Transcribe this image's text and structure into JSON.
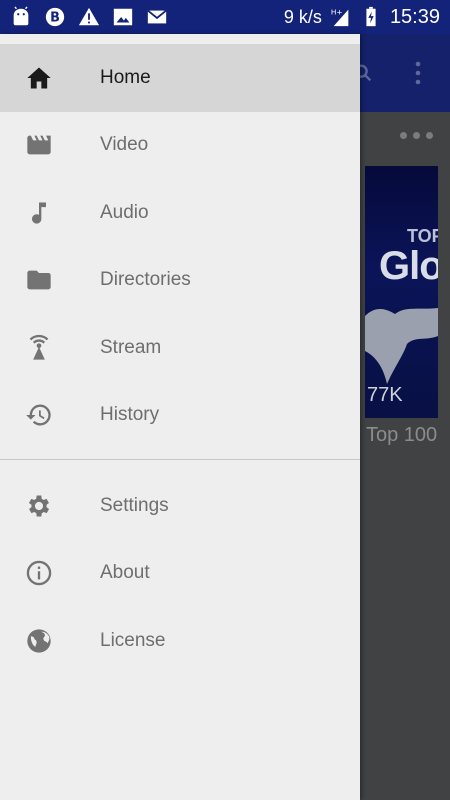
{
  "status_bar": {
    "left_icons": [
      "android-icon",
      "b-circle-icon",
      "warning-icon",
      "image-icon",
      "mail-icon"
    ],
    "speed": "9 k/s",
    "network": "H+",
    "time": "15:39"
  },
  "background_app": {
    "thumbnail_title_small": "TOP",
    "thumbnail_title_large": "Glo",
    "thumbnail_views": "77K",
    "caption": "Top 100"
  },
  "drawer": {
    "primary_items": [
      {
        "label": "Home",
        "icon": "home-icon",
        "selected": true
      },
      {
        "label": "Video",
        "icon": "video-icon"
      },
      {
        "label": "Audio",
        "icon": "music-note-icon"
      },
      {
        "label": "Directories",
        "icon": "folder-icon"
      },
      {
        "label": "Stream",
        "icon": "stream-antenna-icon"
      },
      {
        "label": "History",
        "icon": "history-icon"
      }
    ],
    "secondary_items": [
      {
        "label": "Settings",
        "icon": "gear-icon"
      },
      {
        "label": "About",
        "icon": "info-icon"
      },
      {
        "label": "License",
        "icon": "globe-icon"
      }
    ]
  },
  "colors": {
    "status_bar": "#14237a",
    "drawer_bg": "#eeeeee",
    "selected_bg": "#d6d6d6",
    "icon_gray": "#737373",
    "icon_selected": "#1a1a1a"
  }
}
